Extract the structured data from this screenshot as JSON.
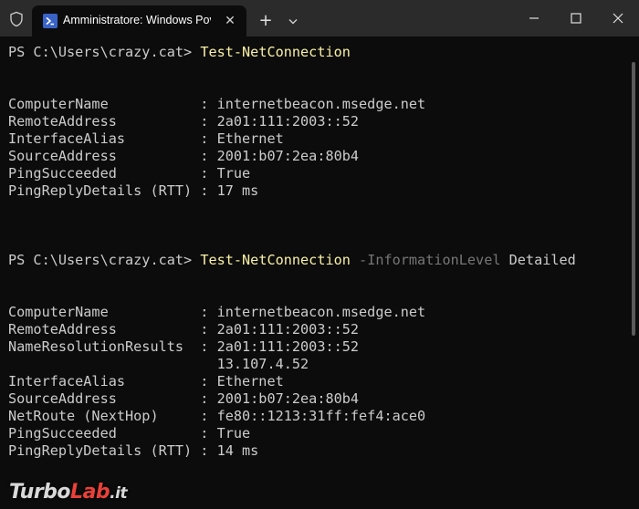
{
  "titlebar": {
    "tab_title": "Amministratore: Windows Pov",
    "close_tab_glyph": "✕",
    "new_tab_glyph": "+",
    "icons": [
      "shield-icon",
      "powershell-icon",
      "close-icon",
      "plus-icon",
      "chevron-down-icon",
      "minimize-icon",
      "maximize-icon",
      "close-window-icon"
    ]
  },
  "terminal": {
    "prompt1": "PS C:\\Users\\crazy.cat> ",
    "cmd1": "Test-NetConnection",
    "block1": [
      "ComputerName           : internetbeacon.msedge.net",
      "RemoteAddress          : 2a01:111:2003::52",
      "InterfaceAlias         : Ethernet",
      "SourceAddress          : 2001:b07:2ea:80b4",
      "PingSucceeded          : True",
      "PingReplyDetails (RTT) : 17 ms"
    ],
    "prompt2": "PS C:\\Users\\crazy.cat> ",
    "cmd2": "Test-NetConnection",
    "param2": " -InformationLevel",
    "arg2": " Detailed",
    "block2": [
      "ComputerName           : internetbeacon.msedge.net",
      "RemoteAddress          : 2a01:111:2003::52",
      "NameResolutionResults  : 2a01:111:2003::52",
      "                         13.107.4.52",
      "InterfaceAlias         : Ethernet",
      "SourceAddress          : 2001:b07:2ea:80b4",
      "NetRoute (NextHop)     : fe80::1213:31ff:fef4:ace0",
      "PingSucceeded          : True",
      "PingReplyDetails (RTT) : 14 ms"
    ]
  },
  "watermark": {
    "part1": "Turbo",
    "part2": "Lab",
    "part3": ".it"
  },
  "colors": {
    "background": "#0c0c0c",
    "titlebar": "#2b2b2b",
    "command": "#f9f1a5",
    "parameter": "#767676",
    "text": "#cccccc"
  }
}
